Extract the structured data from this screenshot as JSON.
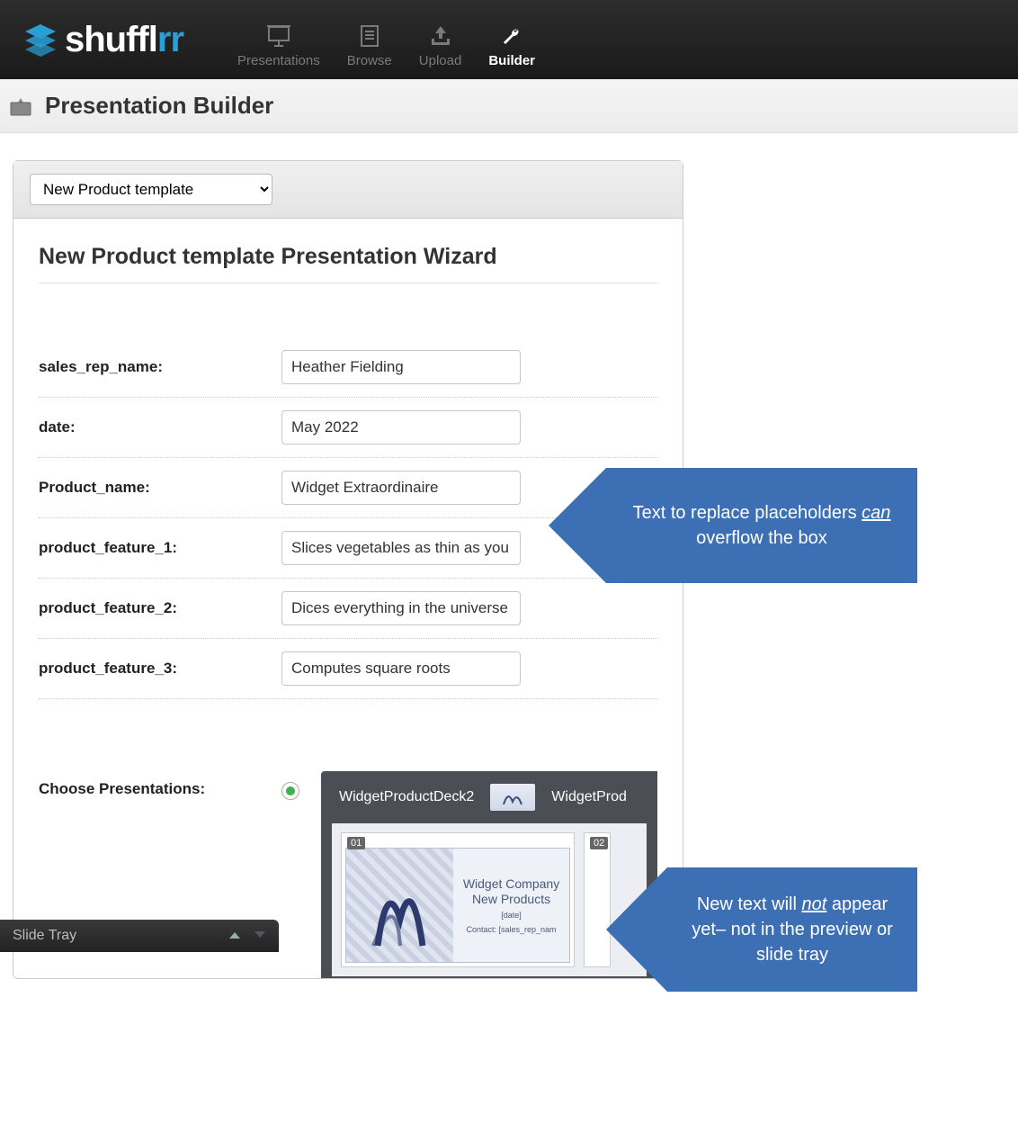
{
  "brand": {
    "name_pre": "shuffl",
    "name_accent": "rr"
  },
  "nav": {
    "items": [
      {
        "label": "Presentations"
      },
      {
        "label": "Browse"
      },
      {
        "label": "Upload"
      },
      {
        "label": "Builder"
      }
    ]
  },
  "page_title": "Presentation Builder",
  "template_select": "New Product template",
  "wizard_title": "New Product template Presentation Wizard",
  "fields": [
    {
      "label": "sales_rep_name:",
      "value": "Heather Fielding"
    },
    {
      "label": "date:",
      "value": "May 2022"
    },
    {
      "label": "Product_name:",
      "value": "Widget Extraordinaire"
    },
    {
      "label": "product_feature_1:",
      "value": "Slices vegetables as thin as you c"
    },
    {
      "label": "product_feature_2:",
      "value": "Dices everything in the universe"
    },
    {
      "label": "product_feature_3:",
      "value": "Computes square roots"
    }
  ],
  "choose_label": "Choose Presentations:",
  "decks": {
    "tab1": "WidgetProductDeck2",
    "tab2": "WidgetProd"
  },
  "slide": {
    "num1": "01",
    "num2": "02",
    "title_l1": "Widget Company",
    "title_l2": "New Products",
    "date_ph": "[date]",
    "contact_ph": "Contact: [sales_rep_nam"
  },
  "tray_label": "Slide Tray",
  "callout1_pre": "Text to replace placeholders ",
  "callout1_em": "can",
  "callout1_post": " overflow the box",
  "callout2_pre": "New text will ",
  "callout2_em": "not",
  "callout2_post": " appear yet– not in the preview or slide tray"
}
